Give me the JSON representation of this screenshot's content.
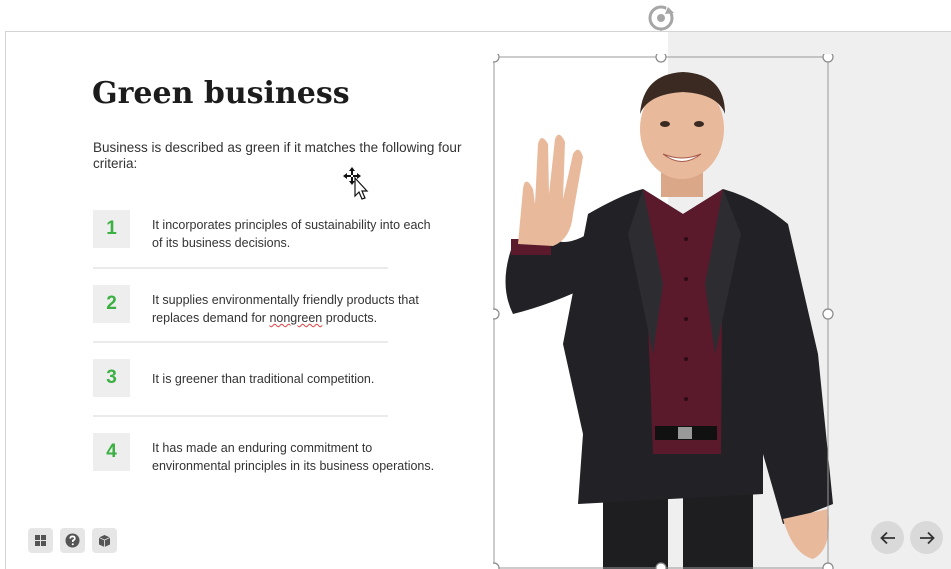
{
  "slide": {
    "title": "Green business",
    "intro": "Business is described as green if it matches the following four criteria:",
    "criteria": [
      {
        "number": "1",
        "line1": "It incorporates principles of sustainability into each",
        "line2": "of its business decisions."
      },
      {
        "number": "2",
        "line1": "It supplies environmentally friendly products that",
        "line2_pre": "replaces demand for ",
        "line2_flag": "nongreen",
        "line2_post": " products."
      },
      {
        "number": "3",
        "line1": "It is greener than traditional competition."
      },
      {
        "number": "4",
        "line1": "It has made an enduring commitment to",
        "line2": "environmental principles in its business operations."
      }
    ]
  },
  "image": {
    "subject": "man in dark suit holding up four fingers",
    "selected": true
  },
  "controls": {
    "rotate_handle_icon": "rotate-icon",
    "bottom_left": [
      "grid-icon",
      "help-icon",
      "package-icon"
    ],
    "prev_icon": "arrow-left-icon",
    "next_icon": "arrow-right-icon"
  },
  "colors": {
    "accent_green": "#3cb043",
    "number_box_bg": "#eeeeee",
    "selection_border": "#9a9a9a",
    "photo_bg": "#efefef"
  }
}
